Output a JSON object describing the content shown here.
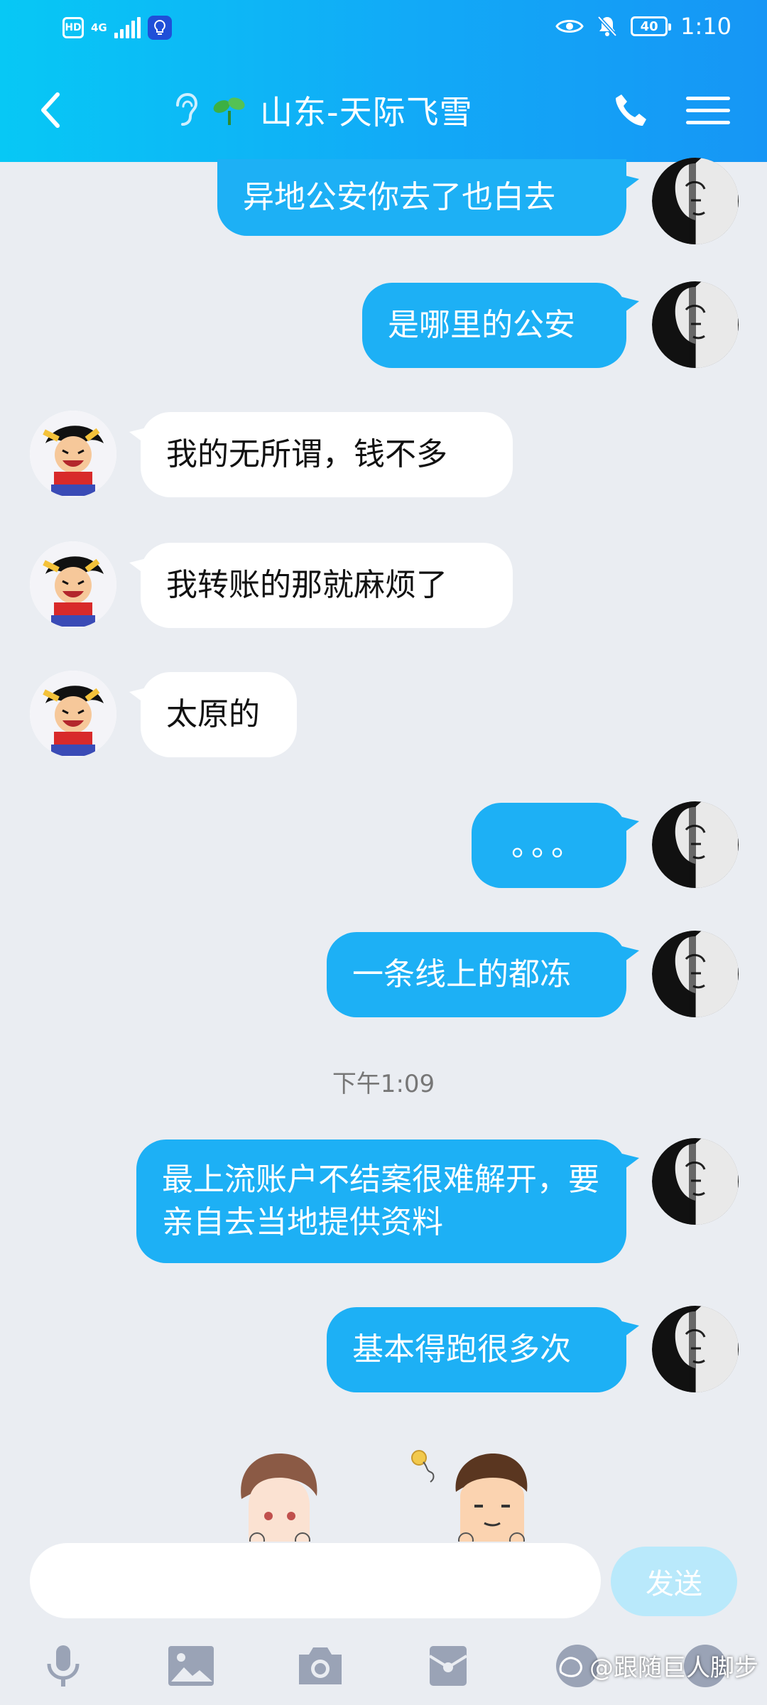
{
  "status": {
    "network": "4G",
    "hd": "HD",
    "battery": "40",
    "time": "1:10"
  },
  "header": {
    "contact_name": "山东-天际飞雪"
  },
  "messages": [
    {
      "side": "out",
      "text": "异地公安你去了也白去"
    },
    {
      "side": "out",
      "text": "是哪里的公安"
    },
    {
      "side": "in",
      "text": "我的无所谓，钱不多"
    },
    {
      "side": "in",
      "text": "我转账的那就麻烦了"
    },
    {
      "side": "in",
      "text": "太原的"
    },
    {
      "side": "out",
      "text": "。。。"
    },
    {
      "side": "out",
      "text": "一条线上的都冻"
    },
    {
      "side": "out",
      "text": "最上流账户不结案很难解开，要亲自去当地提供资料"
    },
    {
      "side": "out",
      "text": "基本得跑很多次"
    }
  ],
  "timestamp": "下午1:09",
  "input": {
    "placeholder": "",
    "send_label": "发送"
  },
  "toolbar": {
    "icons": [
      "microphone-icon",
      "image-icon",
      "camera-icon",
      "red-packet-icon",
      "emoji-icon",
      "plus-icon"
    ]
  },
  "watermark": "@跟随巨人脚步",
  "colors": {
    "header_start": "#07c8f5",
    "header_end": "#1696f5",
    "outgoing_bubble": "#1db0f5",
    "incoming_bubble": "#ffffff",
    "background": "#eaedf2",
    "send_disabled": "#b9e9fb"
  }
}
